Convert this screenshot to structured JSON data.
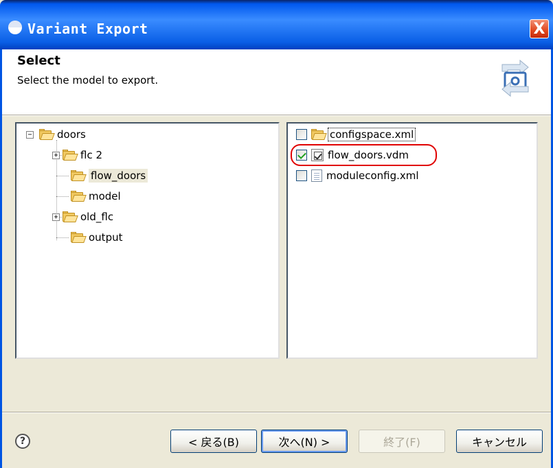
{
  "window": {
    "title": "Variant Export",
    "close_label": "X"
  },
  "header": {
    "title": "Select",
    "description": "Select the model to export."
  },
  "tree": {
    "root": {
      "label": "doors",
      "expander": "−"
    },
    "items": [
      {
        "label": "flc 2",
        "expander": "+"
      },
      {
        "label": "flow_doors",
        "selected": true
      },
      {
        "label": "model"
      },
      {
        "label": "old_flc",
        "expander": "+"
      },
      {
        "label": "output"
      }
    ]
  },
  "files": [
    {
      "label": "configspace.xml",
      "checked": false,
      "icon": "folder-icon"
    },
    {
      "label": "flow_doors.vdm",
      "checked": true,
      "icon": "vdm-file-icon"
    },
    {
      "label": "moduleconfig.xml",
      "checked": false,
      "icon": "xml-file-icon"
    }
  ],
  "buttons": {
    "help": "?",
    "back": "< 戻る(B)",
    "next": "次へ(N) >",
    "finish": "終了(F)",
    "cancel": "キャンセル"
  },
  "colors": {
    "highlight": "#e00000",
    "titlebar": "#0054e3"
  }
}
